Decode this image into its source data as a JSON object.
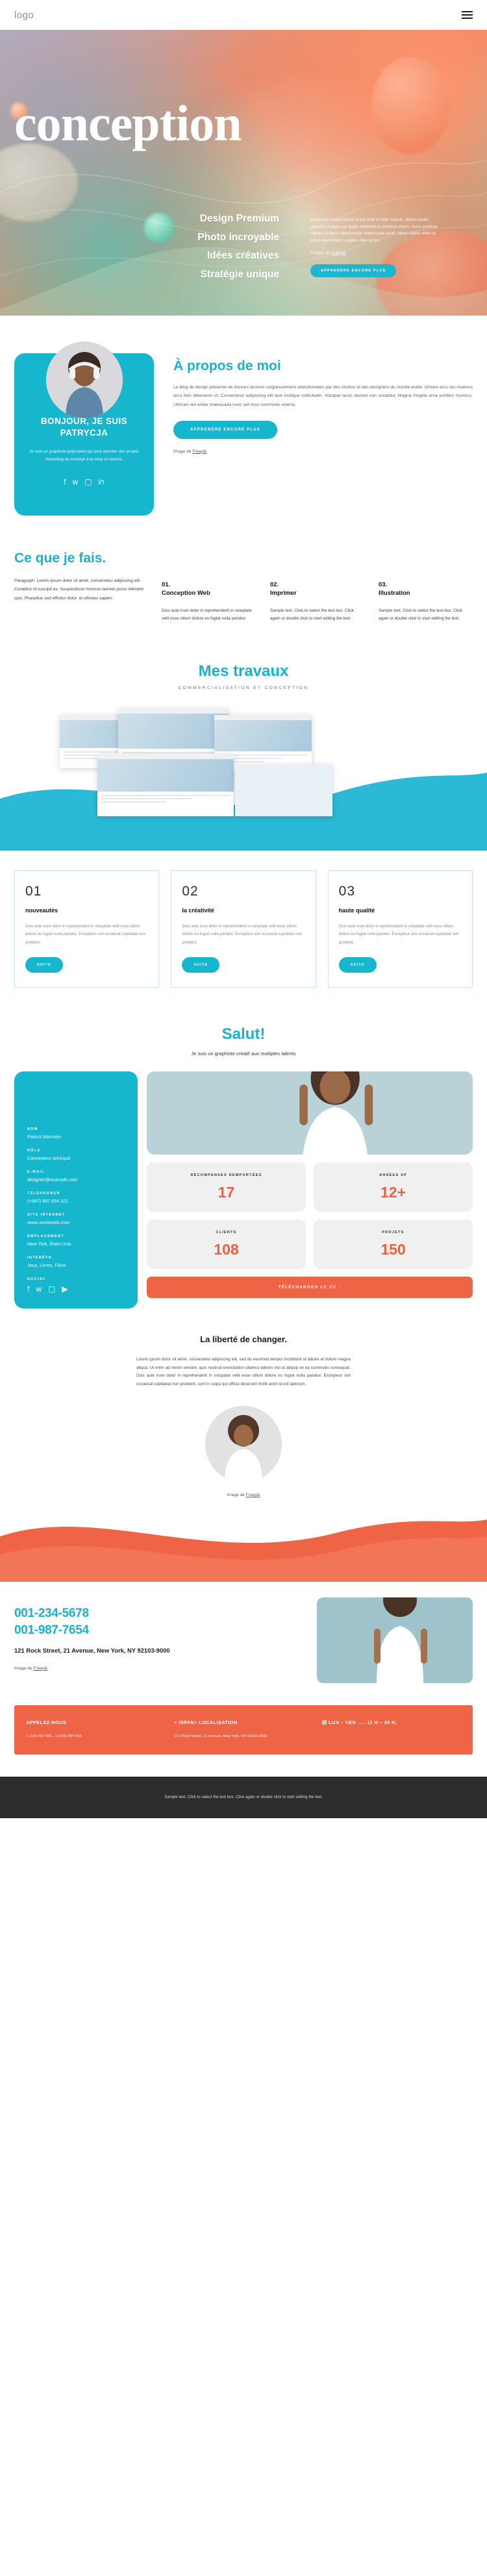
{
  "header": {
    "logo": "logo",
    "menu_icon": "hamburger-menu-icon"
  },
  "hero": {
    "title": "conception",
    "features": [
      "Design Premium",
      "Photo incroyable",
      "Idées créatives",
      "Stratégie unique"
    ],
    "paragraph": "Dignissim suspendisse in est ante in nibh mauris. Varius quam quisque id diam vel quam elementum pulvinar etiam. Nunc pulvinar sapien et ligula ullamcorper malesuada proin. Nunc mattis enim ut tellus elementum sagittis vitae et leo.",
    "credit_prefix": "Images de ",
    "credit_link": "Freepik",
    "cta": "APPRENDRE ENCORE PLUS"
  },
  "about": {
    "card_title": "BONJOUR, JE SUIS PATRYCJA",
    "card_text": "Je suis un graphiste polyvalent qui peut aborder des projets marketing du concept à la mise en œuvre.",
    "socials": [
      "facebook-icon",
      "twitter-icon",
      "instagram-icon",
      "linkedin-icon"
    ],
    "heading": "À propos de moi",
    "paragraph": "Le blog de design présente de bonnes œuvres soigneusement sélectionnées par des studios et des designers du monde entier. Ornare arcu dui vivamus arcu felis bibendum ut. Consectetur adipiscing elit duis tristique sollicitudin. Volutpat lacus laoreet non curabitur. Magna fringilla urna porttitor rhoncus. Ultricies leo entier malesuada nunc vel risus commodo viverra.",
    "cta": "APPRENDRE ENCORE PLUS",
    "credit_prefix": "Image de ",
    "credit_link": "Freepik"
  },
  "services": {
    "heading": "Ce que je fais.",
    "intro": "Paragraph. Lorem ipsum dolor sit amet, consectetur adipiscing elit. Curabitur id suscipit ex. Suspendisse rhoncus laoreet purus élément quis. Phasellus sed efficitur dolor, et ultricies sapien.",
    "items": [
      {
        "num": "01.",
        "title": "Conception Web",
        "text": "Duis aute irure dolor in reprehenderit in voluptate velit esse cillum dolore eu fugiat nulla pariatur."
      },
      {
        "num": "02.",
        "title": "Imprimer",
        "text": "Sample text. Click to select the text box. Click again or double click to start editing the text."
      },
      {
        "num": "03.",
        "title": "Illustration",
        "text": "Sample text. Click to select the text box. Click again or double click to start editing the text."
      }
    ]
  },
  "works": {
    "heading": "Mes travaux",
    "subheading": "COMMERCIALISATION ET CONCEPTION"
  },
  "cards": [
    {
      "num": "01",
      "title": "nouveautés",
      "text": "Duis aute irure dolor in reprehenderit in voluptate velit esse cillum dolore eu fugiat nulla pariatur. Excepteur sint occaecat cupidatat non proident.",
      "button": "SUITE"
    },
    {
      "num": "02",
      "title": "la créativité",
      "text": "Duis aute irure dolor in reprehenderit in voluptate velit esse cillum dolore eu fugiat nulla pariatur. Excepteur sint occaecat cupidatat non proident.",
      "button": "SUITE"
    },
    {
      "num": "03",
      "title": "haute qualité",
      "text": "Duis aute irure dolor in reprehenderit in voluptate velit esse cillum dolore eu fugiat nulla pariatur. Excepteur sint occaecat cupidatat non proident.",
      "button": "SUITE"
    }
  ],
  "salut": {
    "heading": "Salut!",
    "subheading": "Je suis un graphiste créatif aux multiples talents",
    "profile": [
      {
        "label": "NOM",
        "value": "Patrick Morrison"
      },
      {
        "label": "RÔLE",
        "value": "Concepteur principal"
      },
      {
        "label": "E-MAIL",
        "value": "designer@example.com"
      },
      {
        "label": "TÉLÉPHONER",
        "value": "(+987) 987 654 321"
      },
      {
        "label": "SITE INTERNET",
        "value": "www.unsiteweb.com"
      },
      {
        "label": "EMPLACEMENT",
        "value": "New York, États-Unis"
      },
      {
        "label": "INTÉRÊTS",
        "value": "Jeux, Livres, Films"
      }
    ],
    "social_label": "SOCIAL",
    "socials": [
      "facebook-icon",
      "twitter-icon",
      "instagram-icon",
      "youtube-icon"
    ],
    "stats": [
      {
        "label": "RÉCOMPENSES REMPORTÉES",
        "value": "17"
      },
      {
        "label": "ANNÉES XP",
        "value": "12+"
      },
      {
        "label": "CLIENTS",
        "value": "108"
      },
      {
        "label": "PROJETS",
        "value": "150"
      }
    ],
    "download_cta": "TÉLÉCHARGER LE CV"
  },
  "liberte": {
    "heading": "La liberté de changer.",
    "paragraph": "Lorem ipsum dolor sit amet, consectetur adipiscing elit, sed do eiusmod tempor incididunt ut labore et dolore magna aliqua. Ut enim ad minim veniam, quis nostrud exercitation ullamco laboris nisi ut aliquip ex ea commodo consequat. Duis aute irure dolor in reprehenderit in voluptate velit esse cillum dolore eu fugiat nulla pariatur. Excepteur sint occaecat cupidatat non proident, sunt in culpa qui officia deserunt mollit anim id est laborum.",
    "credit_prefix": "Image de ",
    "credit_link": "Freepik"
  },
  "contact": {
    "phone1": "001-234-5678",
    "phone2": "001-987-7654",
    "address": "121 Rock Street, 21 Avenue, New York, NY 92103-9000",
    "credit_prefix": "Image de ",
    "credit_link": "Freepik"
  },
  "orange_bar": [
    {
      "title": "APPELEZ-NOUS",
      "text": "1 (234) 567-891, 1 (234) 987-654"
    },
    {
      "title": "< /SPAN> LOCALISATION",
      "text": "121 Rock Street, 21 Avenue, New York, NY 92103-9000"
    },
    {
      "title": "LUN – VEN ..... 11 H – 20 H,",
      "text": ""
    }
  ],
  "footer": {
    "text": "Sample text. Click to select the text box. Click again or double click to start editing the text."
  },
  "colors": {
    "cyan": "#16b6cf",
    "orange": "#ef6444",
    "dark": "#2d2d2d"
  }
}
